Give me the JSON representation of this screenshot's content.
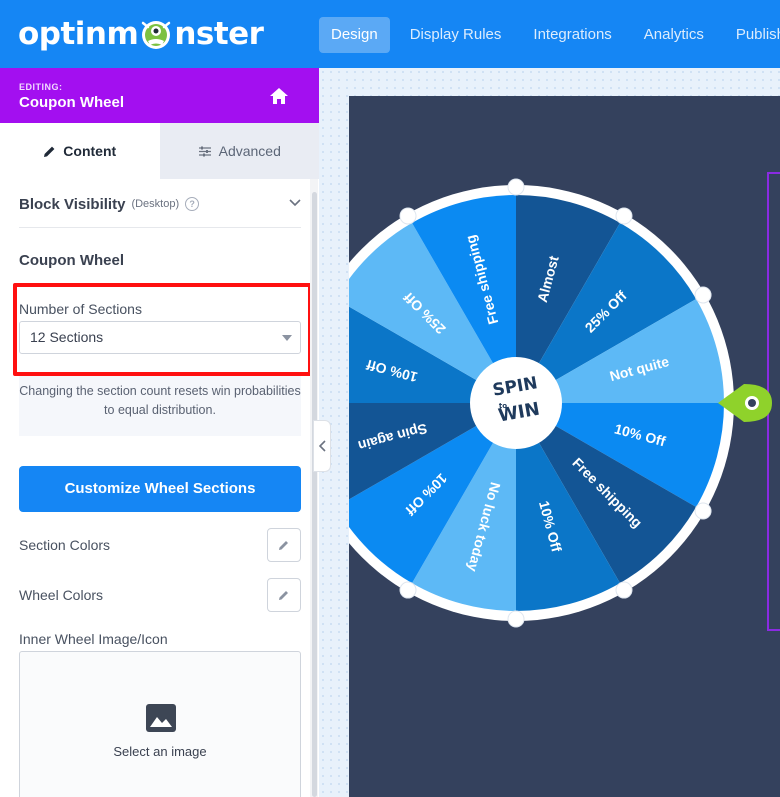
{
  "app": {
    "logo_text_left": "optinm",
    "logo_text_right": "nster",
    "nav": [
      {
        "label": "Design",
        "active": true
      },
      {
        "label": "Display Rules",
        "active": false
      },
      {
        "label": "Integrations",
        "active": false
      },
      {
        "label": "Analytics",
        "active": false
      },
      {
        "label": "Publish",
        "active": false
      }
    ]
  },
  "editing": {
    "label": "EDITING:",
    "title": "Coupon Wheel"
  },
  "tabs": [
    {
      "label": "Content",
      "icon": "pencil-icon",
      "active": true
    },
    {
      "label": "Advanced",
      "icon": "sliders-icon",
      "active": false
    }
  ],
  "sidebar": {
    "block_visibility": {
      "title": "Block Visibility",
      "device": "(Desktop)"
    },
    "coupon_wheel_title": "Coupon Wheel",
    "sections_label": "Number of Sections",
    "sections_value": "12 Sections",
    "note": "Changing the section count resets win probabilities to equal distribution.",
    "customize_button": "Customize Wheel Sections",
    "section_colors_label": "Section Colors",
    "wheel_colors_label": "Wheel Colors",
    "inner_image_label": "Inner Wheel Image/Icon",
    "select_image": "Select an image"
  },
  "wheel": {
    "center_line1": "SPIN",
    "center_line2": "to",
    "center_line3": "WIN",
    "colors": {
      "dark": "#135595",
      "mid": "#0b76c8",
      "bright": "#0b8af2",
      "light": "#5db9f6",
      "rim": "#ffffff",
      "pointer": "#8fd22b"
    },
    "segments": [
      {
        "label": "Almost",
        "color": "dark"
      },
      {
        "label": "25% Off",
        "color": "mid"
      },
      {
        "label": "Not quite",
        "color": "light"
      },
      {
        "label": "10% Off",
        "color": "bright"
      },
      {
        "label": "Free shipping",
        "color": "dark"
      },
      {
        "label": "10% Off",
        "color": "mid"
      },
      {
        "label": "No luck today",
        "color": "light"
      },
      {
        "label": "10% Off",
        "color": "bright"
      },
      {
        "label": "Spin again",
        "color": "dark"
      },
      {
        "label": "10% Off",
        "color": "mid"
      },
      {
        "label": "25% Off",
        "color": "light"
      },
      {
        "label": "Free shipping",
        "color": "bright"
      }
    ]
  }
}
